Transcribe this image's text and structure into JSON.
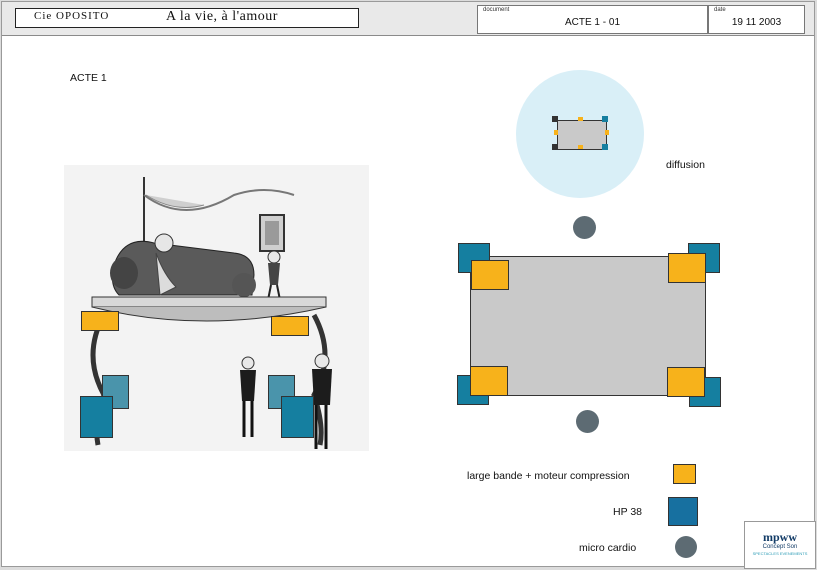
{
  "header": {
    "company": "Cie OPOSITO",
    "show_title": "A la vie, à l'amour",
    "document_key": "document",
    "document_value": "ACTE 1 - 01",
    "date_key": "date",
    "date_value": "19 11 2003"
  },
  "act_label": "ACTE 1",
  "diffusion_label": "diffusion",
  "legend": [
    {
      "label": "large bande + moteur compression",
      "symbol": "orange-square",
      "color": "#f7b21b"
    },
    {
      "label": "HP 38",
      "symbol": "blue-square",
      "color": "#157fa0"
    },
    {
      "label": "micro cardio",
      "symbol": "grey-circle",
      "color": "#5d6b73"
    }
  ],
  "logo": {
    "name": "mpww",
    "sub": "Concept Son",
    "tagline": "SPECTACLES EVENEMENTS"
  },
  "colors": {
    "speaker_orange": "#f7b21b",
    "speaker_blue": "#157fa0",
    "micro": "#5d6b73",
    "stage": "#c9c9c9",
    "diffusion_zone": "#d9eff7"
  }
}
